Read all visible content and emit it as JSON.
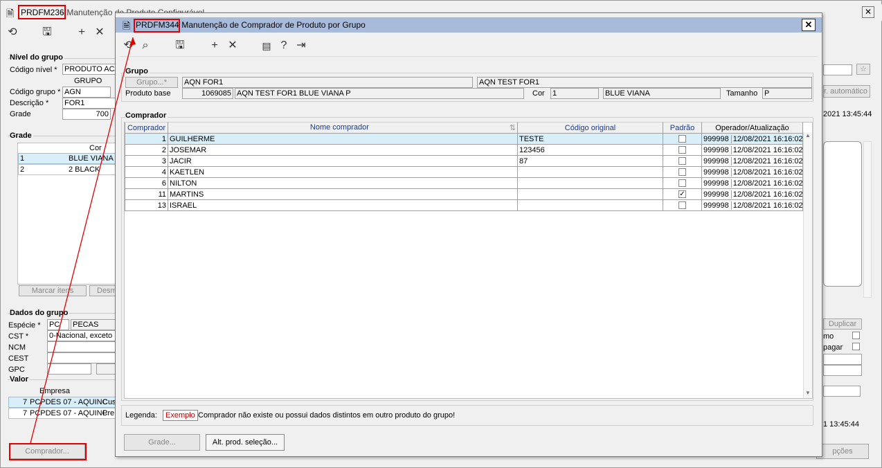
{
  "back": {
    "code": "PRDFM236",
    "title": " - Manutenção de Produto Configurável",
    "nivel": {
      "label": "Nível do grupo",
      "codigo_nivel_label": "Código nível *",
      "codigo_nivel_value": "PRODUTO ACA",
      "grupo_header": "GRUPO",
      "codigo_grupo_label": "Código grupo *",
      "codigo_grupo_value": "AGN",
      "descricao_label": "Descrição *",
      "descricao_value": "FOR1",
      "grade_label": "Grade",
      "grade_value": "700"
    },
    "grade": {
      "label": "Grade",
      "cor_header": "Cor",
      "rows": [
        {
          "n": "1",
          "cor": "BLUE VIANA"
        },
        {
          "n": "2",
          "cor": "2 BLACK"
        }
      ],
      "marcar_itens": "Marcar itens",
      "desm": "Desm"
    },
    "dados": {
      "label": "Dados do grupo",
      "especie_label": "Espécie *",
      "especie_code": "PC",
      "especie_desc": "PECAS",
      "cst_label": "CST *",
      "cst_value": "0-Nacional, exceto",
      "ncm_label": "NCM",
      "cest_label": "CEST",
      "gpc_label": "GPC"
    },
    "valor": {
      "label": "Valor",
      "empresa_header": "Empresa",
      "rows": [
        {
          "n": "7",
          "empresa": "PCPDES 07 - AQUINC",
          "extra": "Cus"
        },
        {
          "n": "7",
          "empresa": "PCPDES 07 - AQUINC",
          "extra": "Pre"
        }
      ]
    },
    "comprador_button": "Comprador...",
    "right": {
      "auto_button": "r. automático",
      "date1": "2021 13:45:44",
      "duplicar": "Duplicar",
      "mo": "mo",
      "pagar": "pagar",
      "date2": "1 13:45:44",
      "opcoes": "pções"
    }
  },
  "front": {
    "code": "PRDFM344",
    "title": " - Manutenção de Comprador de Produto por Grupo",
    "grupo": {
      "label": "Grupo",
      "grupo_button": "Grupo...*",
      "grupo_code": "AQN FOR1",
      "grupo_desc": "AQN TEST FOR1",
      "produto_base_label": "Produto base",
      "produto_base_code": "1069085",
      "produto_base_desc": "AQN TEST FOR1 BLUE VIANA P",
      "cor_label": "Cor",
      "cor_code": "1",
      "cor_desc": "BLUE VIANA",
      "tamanho_label": "Tamanho",
      "tamanho_value": "P"
    },
    "comprador": {
      "label": "Comprador",
      "headers": {
        "comprador": "Comprador",
        "nome": "Nome comprador",
        "codigo_original": "Código original",
        "padrao": "Padrão",
        "operador": "Operador/Atualização"
      },
      "rows": [
        {
          "id": "1",
          "nome": "GUILHERME",
          "codigo": "TESTE",
          "padrao": false,
          "op": "999998",
          "data": "12/08/2021 16:16:02"
        },
        {
          "id": "2",
          "nome": "JOSEMAR",
          "codigo": "123456",
          "padrao": false,
          "op": "999998",
          "data": "12/08/2021 16:16:02"
        },
        {
          "id": "3",
          "nome": "JACIR",
          "codigo": "87",
          "padrao": false,
          "op": "999998",
          "data": "12/08/2021 16:16:02"
        },
        {
          "id": "4",
          "nome": "KAETLEN",
          "codigo": "",
          "padrao": false,
          "op": "999998",
          "data": "12/08/2021 16:16:02"
        },
        {
          "id": "6",
          "nome": "NILTON",
          "codigo": "",
          "padrao": false,
          "op": "999998",
          "data": "12/08/2021 16:16:02"
        },
        {
          "id": "11",
          "nome": "MARTINS",
          "codigo": "",
          "padrao": true,
          "op": "999998",
          "data": "12/08/2021 16:16:02"
        },
        {
          "id": "13",
          "nome": "ISRAEL",
          "codigo": "",
          "padrao": false,
          "op": "999998",
          "data": "12/08/2021 16:16:02"
        }
      ]
    },
    "legenda": {
      "label": "Legenda:",
      "exemplo": "Exemplo",
      "text": "Comprador não existe ou possui dados distintos em outro produto do grupo!"
    },
    "buttons": {
      "grade": "Grade...",
      "alt_prod": "Alt. prod. seleção..."
    },
    "close": "✕"
  }
}
